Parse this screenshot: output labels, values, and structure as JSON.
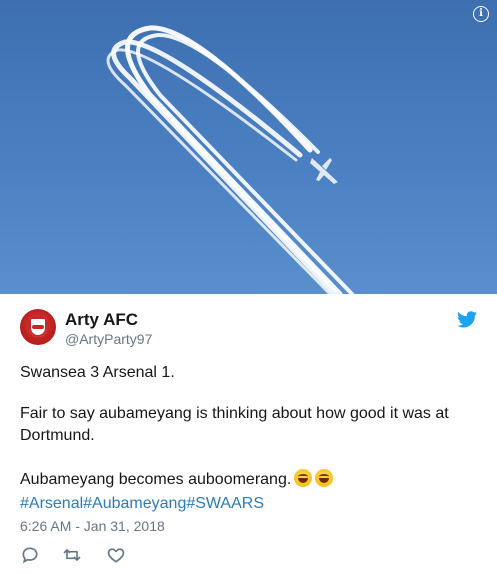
{
  "author": {
    "name": "Arty AFC",
    "handle": "@ArtyParty97"
  },
  "tweet": {
    "line1": "Swansea 3 Arsenal 1.",
    "line2": "Fair to say aubameyang is thinking about how good it was at Dortmund.",
    "line3": "Aubameyang becomes auboomerang.",
    "hashtags": [
      "#Arsenal",
      "#Aubameyang",
      "#SWAARS"
    ],
    "emoji": [
      "grinning-face",
      "grinning-face"
    ]
  },
  "timestamp": "6:26 AM - Jan 31, 2018",
  "media": {
    "info_symbol": "i",
    "sky_color": "#4a80c2",
    "contrail_color": "#ffffff"
  },
  "colors": {
    "link": "#2b7bb9",
    "twitter_blue": "#1da1f2",
    "secondary_text": "#657786",
    "avatar_red": "#c62828"
  },
  "icons": {
    "reply": "speech-bubble-icon",
    "retweet": "retweet-icon",
    "like": "heart-icon",
    "brand": "twitter-bird-icon",
    "info": "info-icon"
  }
}
